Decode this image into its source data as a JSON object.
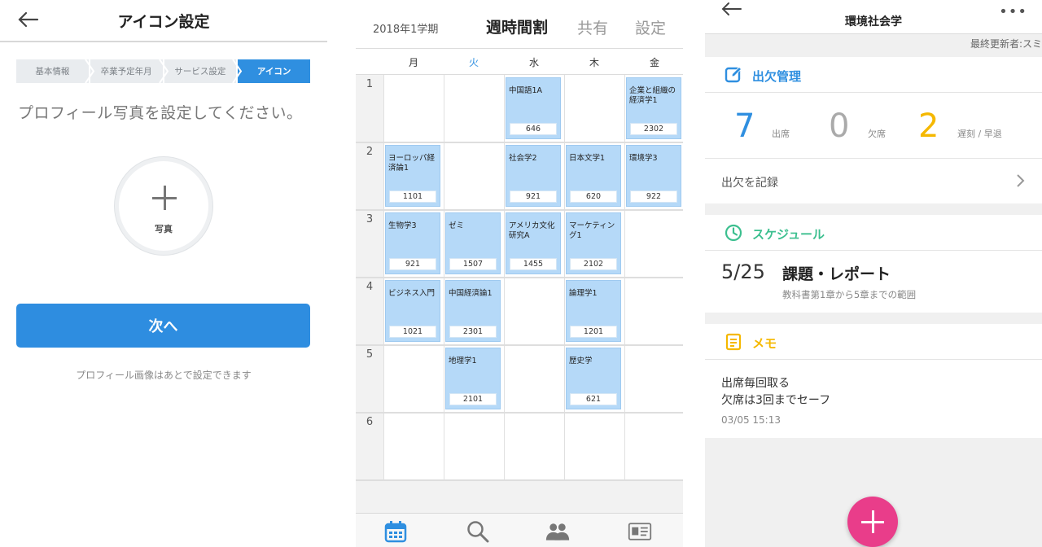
{
  "icon_setup": {
    "title": "アイコン設定",
    "steps": [
      "基本情報",
      "卒業予定年月",
      "サービス設定",
      "アイコン"
    ],
    "active_step": 3,
    "prompt": "プロフィール写真を設定してください。",
    "photo_label": "写真",
    "next_button": "次へ",
    "note": "プロフィール画像はあとで設定できます",
    "accent_color": "#2e8de0"
  },
  "timetable": {
    "term": "2018年1学期",
    "title": "週時間割",
    "share": "共有",
    "settings": "設定",
    "days": [
      "月",
      "火",
      "水",
      "木",
      "金"
    ],
    "today_index": 1,
    "periods": [
      "1",
      "2",
      "3",
      "4",
      "5",
      "6"
    ],
    "classes": [
      {
        "period": 1,
        "day": 2,
        "name": "中国語1A",
        "room": "646"
      },
      {
        "period": 1,
        "day": 4,
        "name": "企業と組織の経済学1",
        "room": "2302"
      },
      {
        "period": 2,
        "day": 0,
        "name": "ヨーロッパ経済論1",
        "room": "1101"
      },
      {
        "period": 2,
        "day": 2,
        "name": "社会学2",
        "room": "921"
      },
      {
        "period": 2,
        "day": 3,
        "name": "日本文学1",
        "room": "620"
      },
      {
        "period": 2,
        "day": 4,
        "name": "環境学3",
        "room": "922"
      },
      {
        "period": 3,
        "day": 0,
        "name": "生物学3",
        "room": "921"
      },
      {
        "period": 3,
        "day": 1,
        "name": "ゼミ",
        "room": "1507"
      },
      {
        "period": 3,
        "day": 2,
        "name": "アメリカ文化研究A",
        "room": "1455"
      },
      {
        "period": 3,
        "day": 3,
        "name": "マーケティング1",
        "room": "2102"
      },
      {
        "period": 4,
        "day": 0,
        "name": "ビジネス入門",
        "room": "1021"
      },
      {
        "period": 4,
        "day": 1,
        "name": "中国経済論1",
        "room": "2301"
      },
      {
        "period": 4,
        "day": 3,
        "name": "論理学1",
        "room": "1201"
      },
      {
        "period": 5,
        "day": 1,
        "name": "地理学1",
        "room": "2101"
      },
      {
        "period": 5,
        "day": 3,
        "name": "歴史学",
        "room": "621"
      }
    ],
    "tabs": [
      "calendar-icon",
      "search-icon",
      "people-icon",
      "id-card-icon"
    ],
    "class_color": "#b5d9f8"
  },
  "course_detail": {
    "title": "環境社会学",
    "more": "•••",
    "updated_by": "最終更新者:スミ",
    "attendance": {
      "title": "出欠管理",
      "present_count": "7",
      "present_label": "出席",
      "absent_count": "0",
      "absent_label": "欠席",
      "late_count": "2",
      "late_label": "遅刻 / 早退",
      "record_label": "出欠を記録",
      "color": "#2f8fe0"
    },
    "schedule": {
      "title": "スケジュール",
      "date": "5/25",
      "item_title": "課題・レポート",
      "item_detail": "教科書第1章から5章までの範囲",
      "color": "#3cbf8f"
    },
    "memo": {
      "title": "メモ",
      "line1": "出席毎回取る",
      "line2": "欠席は3回までセーフ",
      "timestamp": "03/05 15:13",
      "color": "#f5b800"
    },
    "fab_color": "#e93d8a"
  }
}
